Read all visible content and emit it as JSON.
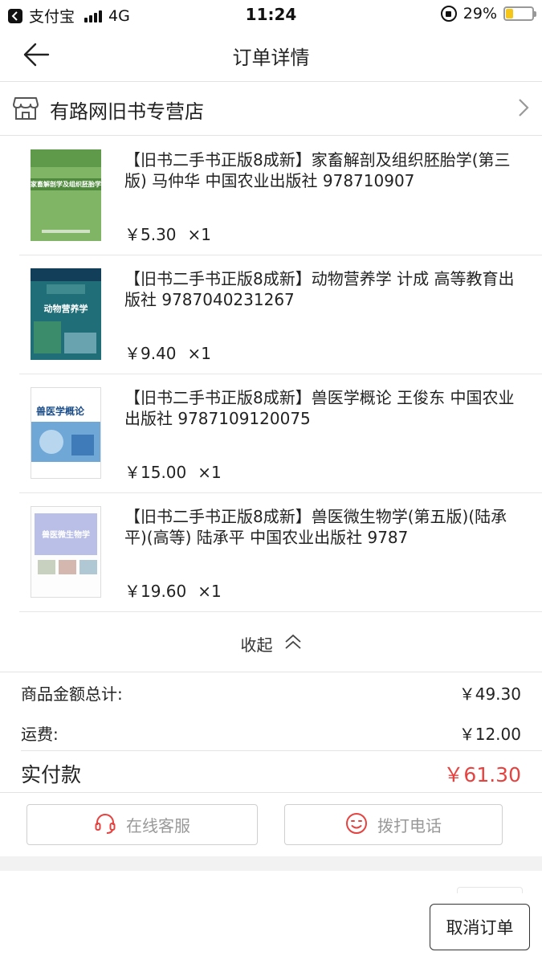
{
  "status_bar": {
    "back_app": "支付宝",
    "network": "4G",
    "time": "11:24",
    "battery": "29%",
    "battery_level": 0.29,
    "battery_color": "#f5c518"
  },
  "nav": {
    "back_icon": "arrow-left-icon",
    "title": "订单详情"
  },
  "store": {
    "icon": "store-icon",
    "name": "有路网旧书专营店",
    "chevron_icon": "chevron-right-icon"
  },
  "items": [
    {
      "title": "【旧书二手书正版8成新】家畜解剖及组织胚胎学(第三版) 马仲华 中国农业出版社 978710907",
      "price": "￥5.30",
      "qty": "×1",
      "cover_title": "家畜解剖学及组织胚胎学",
      "cover_color": "#7fb565"
    },
    {
      "title": "【旧书二手书正版8成新】动物营养学 计成 高等教育出版社 9787040231267",
      "price": "￥9.40",
      "qty": "×1",
      "cover_title": "动物营养学",
      "cover_color": "#1f6e78"
    },
    {
      "title": "【旧书二手书正版8成新】兽医学概论 王俊东 中国农业出版社 9787109120075",
      "price": "￥15.00",
      "qty": "×1",
      "cover_title": "兽医学概论",
      "cover_color": "#ffffff"
    },
    {
      "title": "【旧书二手书正版8成新】兽医微生物学(第五版)(陆承平)(高等) 陆承平 中国农业出版社 9787",
      "price": "￥19.60",
      "qty": "×1",
      "cover_title": "兽医微生物学",
      "cover_color": "#b9bfe6"
    }
  ],
  "collapse": {
    "label": "收起",
    "icon": "double-chevron-up-icon"
  },
  "summary": {
    "goods_total_label": "商品金额总计:",
    "goods_total_value": "￥49.30",
    "shipping_label": "运费:",
    "shipping_value": "￥12.00",
    "paid_label": "实付款",
    "paid_value": "￥61.30",
    "accent_color": "#e64340"
  },
  "contact": {
    "service_label": "在线客服",
    "service_icon": "headset-icon",
    "phone_label": "拨打电话",
    "phone_icon": "smiley-icon"
  },
  "actions": {
    "cancel_label": "取消订单"
  }
}
